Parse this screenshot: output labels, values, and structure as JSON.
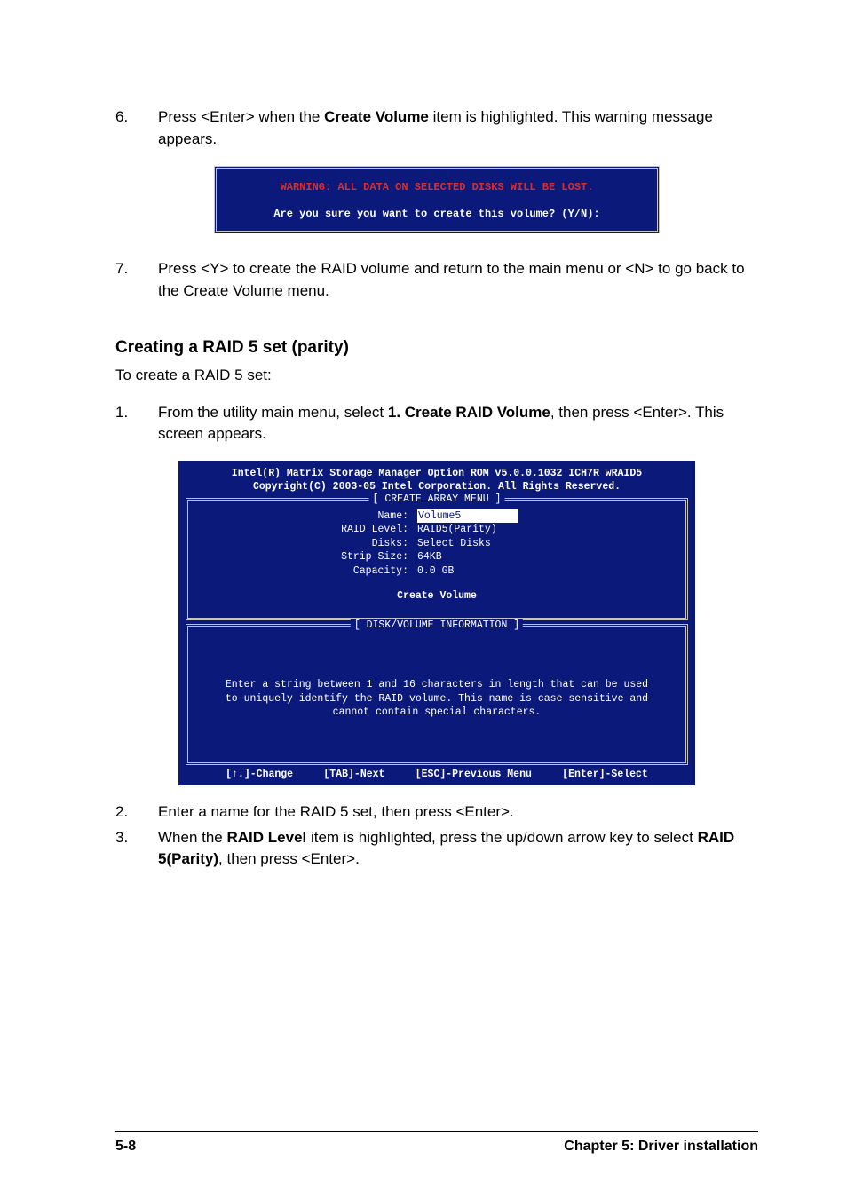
{
  "step6": {
    "num": "6.",
    "pre": "Press <Enter> when the ",
    "bold": "Create Volume",
    "post": " item is highlighted. This warning message appears."
  },
  "warning": {
    "line1": "WARNING: ALL DATA ON SELECTED DISKS WILL BE LOST.",
    "line2": "Are you sure you want to create this volume? (Y/N):"
  },
  "step7": {
    "num": "7.",
    "text": "Press <Y> to create the RAID volume and return to the main menu or <N> to go back to the Create Volume menu."
  },
  "section": {
    "heading": "Creating a RAID 5 set (parity)",
    "intro": "To create a RAID 5 set:"
  },
  "step1": {
    "num": "1.",
    "pre": "From the utility main menu, select ",
    "bold": "1. Create RAID Volume",
    "post": ", then press <Enter>. This screen appears."
  },
  "bios": {
    "hdr1": "Intel(R) Matrix Storage Manager Option ROM v5.0.0.1032 ICH7R wRAID5",
    "hdr2": "Copyright(C) 2003-05 Intel Corporation. All Rights Reserved.",
    "panel1Title": "[ CREATE ARRAY MENU ]",
    "fields": {
      "name_label": "Name:",
      "name_val": "Volume5",
      "raid_label": "RAID Level:",
      "raid_val": "RAID5(Parity)",
      "disks_label": "Disks:",
      "disks_val": "Select Disks",
      "strip_label": "Strip Size:",
      "strip_val": "64KB",
      "cap_label": "Capacity:",
      "cap_val": "0.0  GB"
    },
    "create": "Create Volume",
    "panel2Title": "[ DISK/VOLUME INFORMATION ]",
    "help1": "Enter a string between 1 and 16 characters in length that can be used",
    "help2": "to uniquely identify the RAID volume. This name is case sensitive and",
    "help3": "cannot contain special characters.",
    "footer": {
      "f1": "[↑↓]-Change",
      "f2": "[TAB]-Next",
      "f3": "[ESC]-Previous Menu",
      "f4": "[Enter]-Select"
    }
  },
  "step2": {
    "num": "2.",
    "text": "Enter a name for the RAID 5 set, then press <Enter>."
  },
  "step3": {
    "num": "3.",
    "pre": "When the ",
    "bold1": "RAID Level",
    "mid": " item is highlighted, press the up/down arrow key to select ",
    "bold2": "RAID 5(Parity)",
    "post": ", then press <Enter>."
  },
  "footer": {
    "page": "5-8",
    "chapter": "Chapter 5: Driver installation"
  }
}
